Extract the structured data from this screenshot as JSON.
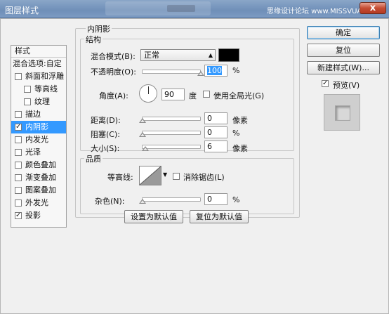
{
  "window": {
    "title": "图层样式",
    "watermark": "思缘设计论坛 www.MISSVUAN.COM",
    "close_label": "x"
  },
  "sidebar": {
    "header": "样式",
    "items": [
      {
        "label": "混合选项:自定",
        "checkbox": false,
        "checked": false,
        "indent": 0,
        "selected": false
      },
      {
        "label": "斜面和浮雕",
        "checkbox": true,
        "checked": false,
        "indent": 0,
        "selected": false
      },
      {
        "label": "等高线",
        "checkbox": true,
        "checked": false,
        "indent": 1,
        "selected": false
      },
      {
        "label": "纹理",
        "checkbox": true,
        "checked": false,
        "indent": 1,
        "selected": false
      },
      {
        "label": "描边",
        "checkbox": true,
        "checked": false,
        "indent": 0,
        "selected": false
      },
      {
        "label": "内阴影",
        "checkbox": true,
        "checked": true,
        "indent": 0,
        "selected": true
      },
      {
        "label": "内发光",
        "checkbox": true,
        "checked": false,
        "indent": 0,
        "selected": false
      },
      {
        "label": "光泽",
        "checkbox": true,
        "checked": false,
        "indent": 0,
        "selected": false
      },
      {
        "label": "颜色叠加",
        "checkbox": true,
        "checked": false,
        "indent": 0,
        "selected": false
      },
      {
        "label": "渐变叠加",
        "checkbox": true,
        "checked": false,
        "indent": 0,
        "selected": false
      },
      {
        "label": "图案叠加",
        "checkbox": true,
        "checked": false,
        "indent": 0,
        "selected": false
      },
      {
        "label": "外发光",
        "checkbox": true,
        "checked": false,
        "indent": 0,
        "selected": false
      },
      {
        "label": "投影",
        "checkbox": true,
        "checked": true,
        "indent": 0,
        "selected": false
      }
    ]
  },
  "panel": {
    "title": "内阴影",
    "structure": {
      "title": "结构",
      "blend_mode_label": "混合模式(B):",
      "blend_mode_value": "正常",
      "shadow_color": "#000000",
      "opacity_label": "不透明度(O):",
      "opacity_value": "100",
      "opacity_unit": "%",
      "angle_label": "角度(A):",
      "angle_value": "90",
      "angle_unit": "度",
      "global_light_label": "使用全局光(G)",
      "global_light_checked": false,
      "distance_label": "距离(D):",
      "distance_value": "0",
      "distance_unit": "像素",
      "choke_label": "阻塞(C):",
      "choke_value": "0",
      "choke_unit": "%",
      "size_label": "大小(S):",
      "size_value": "6",
      "size_unit": "像素"
    },
    "quality": {
      "title": "品质",
      "contour_label": "等高线:",
      "antialias_label": "消除锯齿(L)",
      "antialias_checked": false,
      "noise_label": "杂色(N):",
      "noise_value": "0",
      "noise_unit": "%"
    },
    "default_buttons": {
      "set_default": "设置为默认值",
      "reset_default": "复位为默认值"
    }
  },
  "right": {
    "ok": "确定",
    "reset": "复位",
    "new_style": "新建样式(W)...",
    "preview_label": "预览(V)",
    "preview_checked": true
  }
}
